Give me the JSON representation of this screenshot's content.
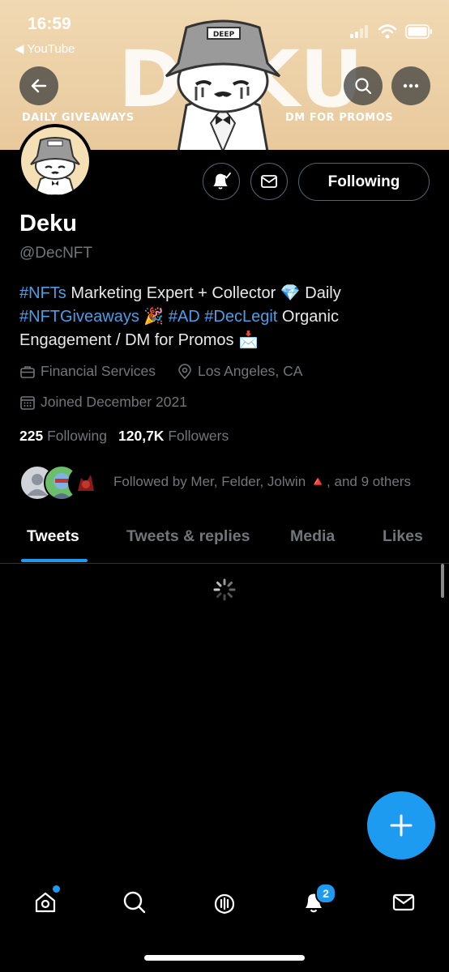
{
  "status_bar": {
    "time": "16:59",
    "back_app": "◀ YouTube"
  },
  "banner": {
    "title": "DEKU",
    "tag_left": "DAILY GIVEAWAYS",
    "tag_right": "DM FOR PROMOS",
    "hat_text": "DEEP",
    "colors": {
      "background": "#eccfa5"
    }
  },
  "header_buttons": {
    "back_icon": "arrow-left-icon",
    "search_icon": "search-icon",
    "more_icon": "more-icon"
  },
  "profile": {
    "name": "Deku",
    "handle": "@DecNFT",
    "bio": {
      "tag1": "#NFTs",
      "text1": " Marketing Expert + Collector 💎 Daily ",
      "tag2": "#NFTGiveaways",
      "text2": " 🎉 ",
      "tag3": "#AD",
      "text3": " ",
      "tag4": "#DecLegit",
      "text4": " Organic Engagement / DM for Promos 📩"
    },
    "category": "Financial Services",
    "location": "Los Angeles, CA",
    "joined": "Joined December 2021",
    "following_count": "225",
    "following_label": "Following",
    "followers_count": "120,7K",
    "followers_label": "Followers",
    "followed_by": "Followed by Mer, Felder, Jolwin 🔺, and 9 others"
  },
  "actions": {
    "following_button": "Following",
    "notify_icon": "bell-add-icon",
    "message_icon": "mail-icon"
  },
  "tabs": [
    {
      "label": "Tweets",
      "active": true
    },
    {
      "label": "Tweets & replies",
      "active": false
    },
    {
      "label": "Media",
      "active": false
    },
    {
      "label": "Likes",
      "active": false
    }
  ],
  "bottom_nav": {
    "items": [
      "home-icon",
      "search-icon",
      "spaces-icon",
      "notifications-icon",
      "messages-icon"
    ],
    "notification_badge": "2"
  },
  "colors": {
    "accent": "#1d9bf0",
    "hashtag": "#4a9fe8",
    "muted": "#71767b"
  }
}
